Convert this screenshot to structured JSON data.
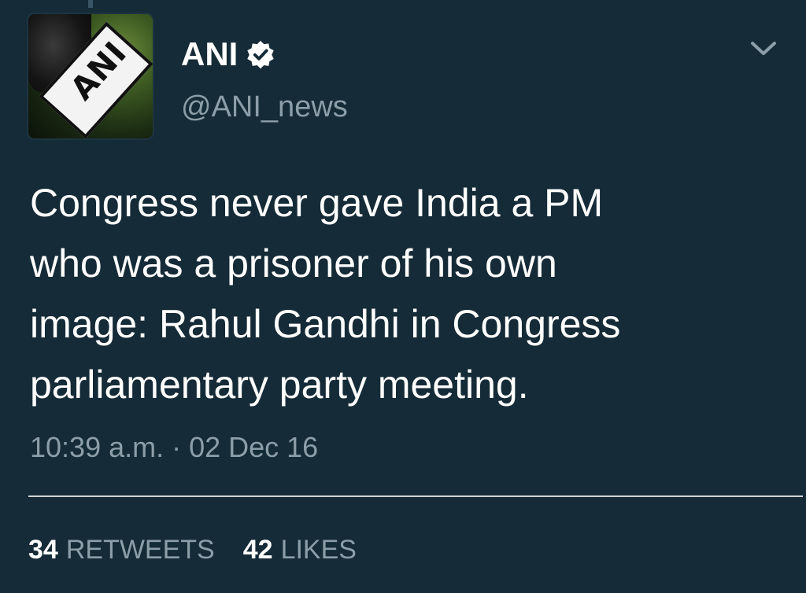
{
  "tweet": {
    "author": {
      "name": "ANI",
      "handle": "@ANI_news",
      "avatar_text": "ANI",
      "verified": true
    },
    "text_lines": [
      "Congress never gave India a PM",
      "who was a prisoner of his own",
      "image: Rahul Gandhi in Congress",
      "parliamentary party meeting."
    ],
    "timestamp": "10:39 a.m. · 02 Dec 16",
    "stats": {
      "retweets_count": "34",
      "retweets_label": "RETWEETS",
      "likes_count": "42",
      "likes_label": "LIKES"
    }
  },
  "icons": {
    "verified": "verified-badge-icon",
    "menu": "chevron-down-icon"
  },
  "colors": {
    "background": "#152b37",
    "text_primary": "#ffffff",
    "text_secondary": "#8c9ea8",
    "divider": "#e6e8e9"
  }
}
